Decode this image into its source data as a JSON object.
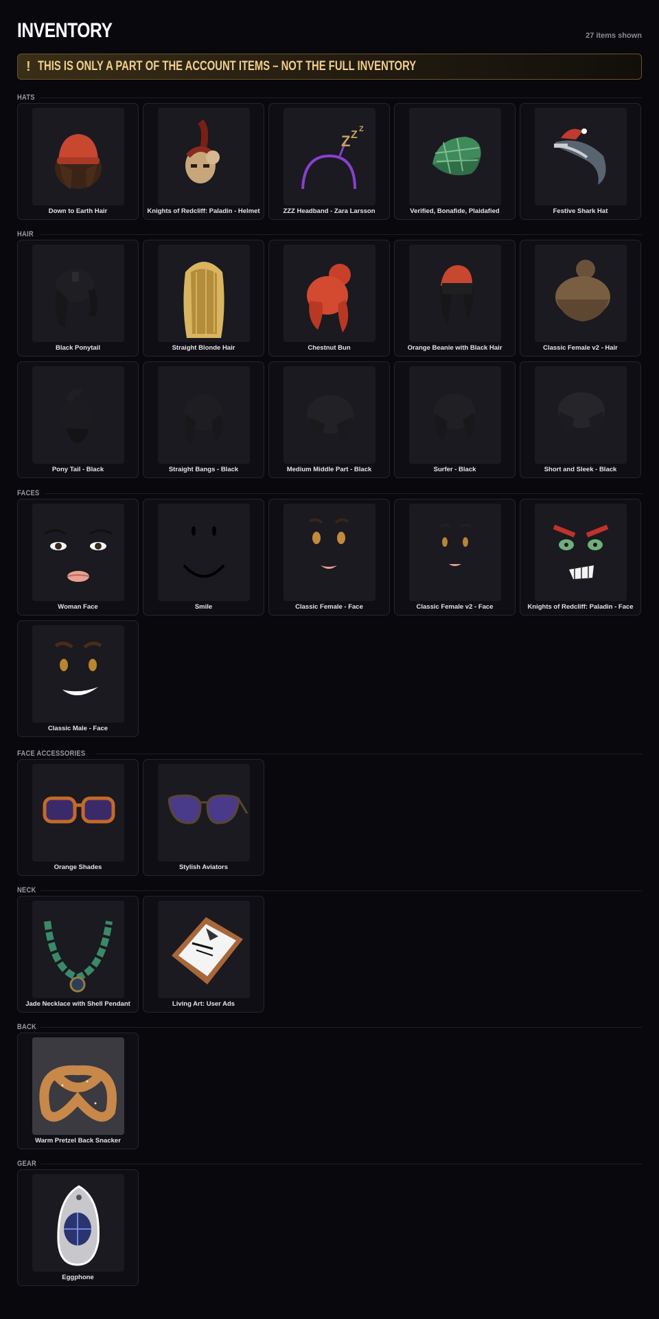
{
  "header": {
    "title": "INVENTORY",
    "count_label": "27 items shown"
  },
  "warning": {
    "icon": "!",
    "text": "THIS IS ONLY A PART OF THE ACCOUNT ITEMS – NOT THE FULL INVENTORY"
  },
  "colors": {
    "background": "#08080d",
    "warning_text": "#f0cf8f",
    "card_bg": "#0e0e14",
    "thumb_bg": "#1a1a20"
  },
  "sections": [
    {
      "label": "HATS",
      "items": [
        {
          "name": "Down to Earth Hair",
          "icon": "red-beanie-brown-hair-icon"
        },
        {
          "name": "Knights of Redcliff: Paladin - Helmet",
          "icon": "paladin-helmet-icon"
        },
        {
          "name": "ZZZ Headband - Zara Larsson",
          "icon": "zzz-headband-icon"
        },
        {
          "name": "Verified, Bonafide, Plaidafied",
          "icon": "plaid-cap-icon"
        },
        {
          "name": "Festive Shark Hat",
          "icon": "shark-hat-icon"
        }
      ]
    },
    {
      "label": "HAIR",
      "items": [
        {
          "name": "Black Ponytail",
          "icon": "black-ponytail-icon"
        },
        {
          "name": "Straight Blonde Hair",
          "icon": "blonde-hair-icon"
        },
        {
          "name": "Chestnut Bun",
          "icon": "red-bun-hair-icon"
        },
        {
          "name": "Orange Beanie with Black Hair",
          "icon": "orange-beanie-hair-icon"
        },
        {
          "name": "Classic Female v2 - Hair",
          "icon": "brown-bun-hair-icon"
        },
        {
          "name": "Pony Tail - Black",
          "icon": "black-pony-tail-icon"
        },
        {
          "name": "Straight Bangs - Black",
          "icon": "black-bangs-hair-icon"
        },
        {
          "name": "Medium Middle Part - Black",
          "icon": "black-middle-part-icon"
        },
        {
          "name": "Surfer - Black",
          "icon": "black-surfer-hair-icon"
        },
        {
          "name": "Short and Sleek - Black",
          "icon": "black-short-hair-icon"
        }
      ]
    },
    {
      "label": "FACES",
      "items": [
        {
          "name": "Woman Face",
          "icon": "woman-face-icon"
        },
        {
          "name": "Smile",
          "icon": "smile-face-icon"
        },
        {
          "name": "Classic Female - Face",
          "icon": "classic-female-face-icon"
        },
        {
          "name": "Classic Female v2 - Face",
          "icon": "classic-female-v2-face-icon"
        },
        {
          "name": "Knights of Redcliff: Paladin - Face",
          "icon": "paladin-face-icon"
        },
        {
          "name": "Classic Male - Face",
          "icon": "classic-male-face-icon"
        }
      ]
    },
    {
      "label": "FACE ACCESSORIES",
      "items": [
        {
          "name": "Orange Shades",
          "icon": "orange-shades-icon"
        },
        {
          "name": "Stylish Aviators",
          "icon": "aviators-icon"
        }
      ]
    },
    {
      "label": "NECK",
      "items": [
        {
          "name": "Jade Necklace with Shell Pendant",
          "icon": "jade-necklace-icon"
        },
        {
          "name": "Living Art: User Ads",
          "icon": "picture-frame-icon"
        }
      ]
    },
    {
      "label": "BACK",
      "items": [
        {
          "name": "Warm Pretzel Back Snacker",
          "icon": "pretzel-icon"
        }
      ]
    },
    {
      "label": "GEAR",
      "items": [
        {
          "name": "Eggphone",
          "icon": "eggphone-icon"
        }
      ]
    }
  ]
}
